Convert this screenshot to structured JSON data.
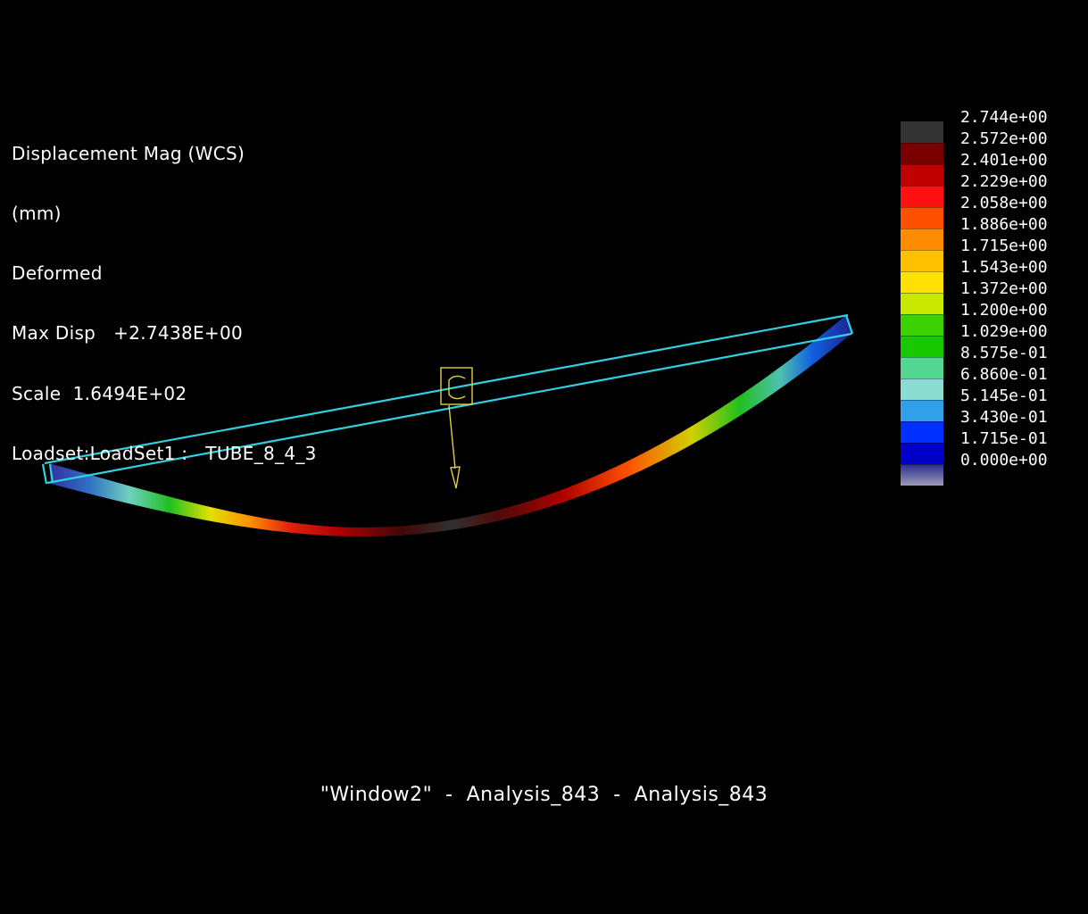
{
  "info": {
    "lines": [
      "Displacement Mag (WCS)",
      "(mm)",
      "Deformed",
      "Max Disp   +2.7438E+00",
      "Scale  1.6494E+02",
      "Loadset:LoadSet1 :   TUBE_8_4_3"
    ]
  },
  "legend": {
    "labels": [
      "2.744e+00",
      "2.572e+00",
      "2.401e+00",
      "2.229e+00",
      "2.058e+00",
      "1.886e+00",
      "1.715e+00",
      "1.543e+00",
      "1.372e+00",
      "1.200e+00",
      "1.029e+00",
      "8.575e-01",
      "6.860e-01",
      "5.145e-01",
      "3.430e-01",
      "1.715e-01",
      "0.000e+00"
    ],
    "colors": [
      "#333333",
      "#7a0000",
      "#c00000",
      "#ff1010",
      "#ff5000",
      "#ff8c00",
      "#ffc000",
      "#ffe000",
      "#c8e800",
      "#3cd200",
      "#18c800",
      "#52d890",
      "#8adcd0",
      "#30a0e8",
      "#0030ff",
      "#0000c8",
      "#2a2a90"
    ],
    "bottom_color": "#9a9ab4"
  },
  "caption": {
    "text": "\"Window2\"  -  Analysis_843  -  Analysis_843"
  },
  "model": {
    "undeformed_color": "#30d0e0",
    "load_marker_color": "#e0d040"
  }
}
